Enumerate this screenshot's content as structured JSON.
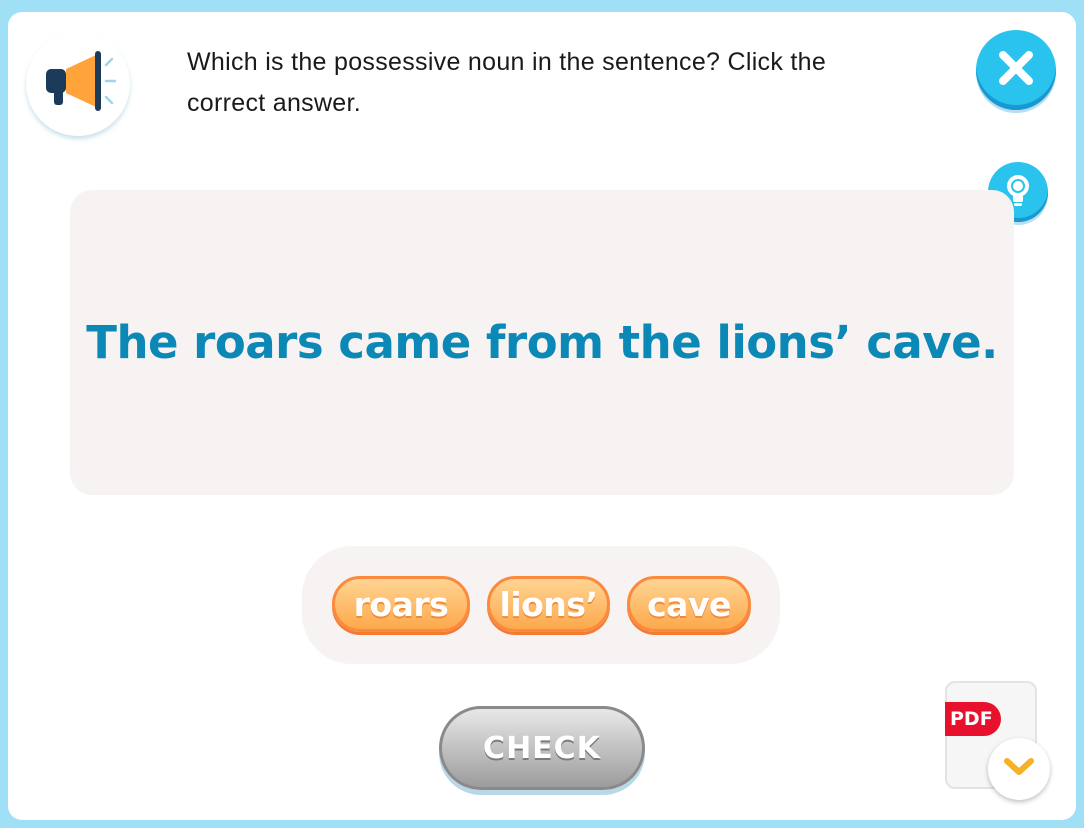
{
  "question": {
    "prompt": "Which is the possessive noun in the sentence? Click the correct answer."
  },
  "sentence": "The roars came from the lions’ cave.",
  "options": [
    "roars",
    "lions’",
    "cave"
  ],
  "buttons": {
    "check_label": "CHECK",
    "pdf_label": "PDF"
  },
  "icons": {
    "speaker": "megaphone-icon",
    "close": "close-icon",
    "hint": "lightbulb-icon",
    "download": "chevron-down-icon"
  },
  "colors": {
    "accent_blue": "#29c3ee",
    "sentence_text": "#0b88b6",
    "option_orange": "#fda94c",
    "pdf_red": "#e8112d"
  }
}
